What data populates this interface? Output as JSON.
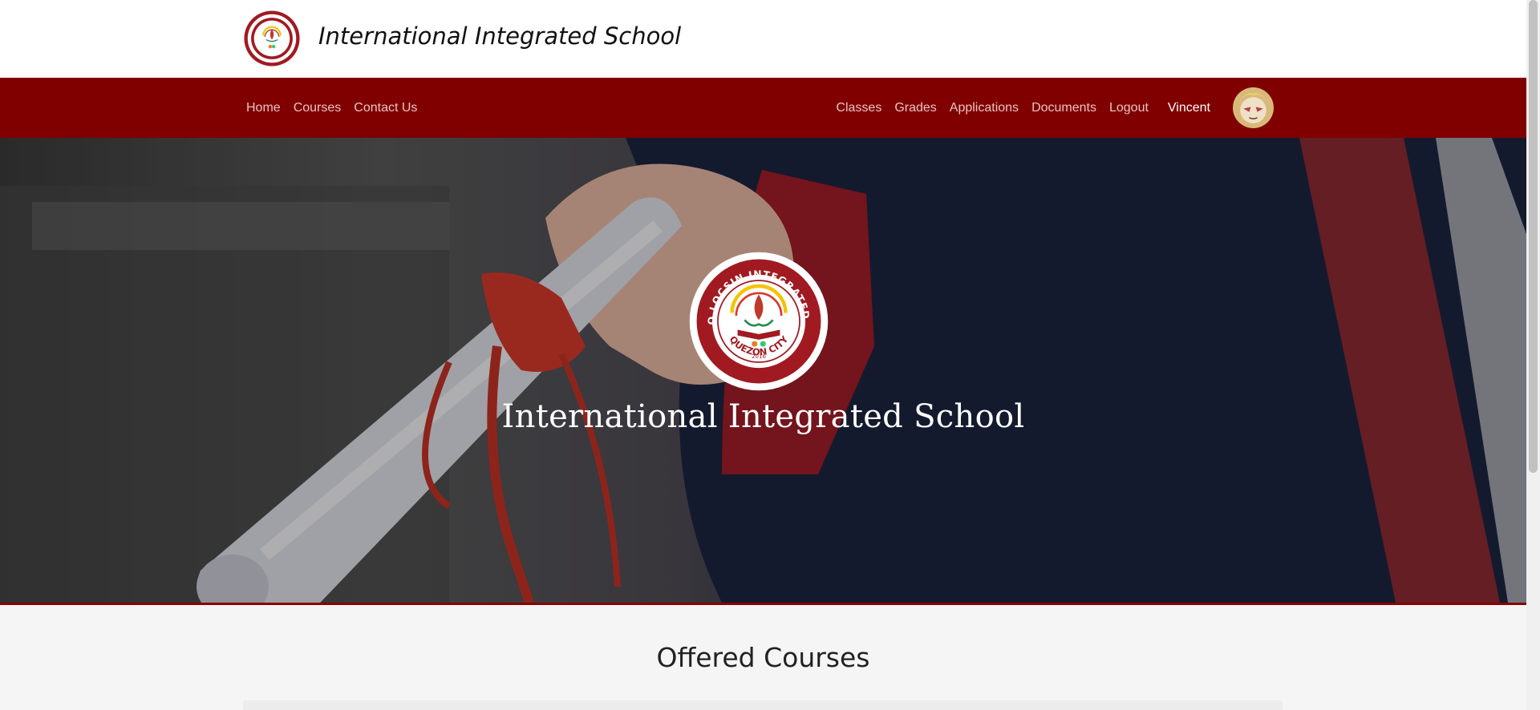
{
  "brand": {
    "title": "International Integrated School",
    "logo_icon": "school-seal-icon"
  },
  "nav": {
    "left": [
      "Home",
      "Courses",
      "Contact Us"
    ],
    "right": [
      "Classes",
      "Grades",
      "Applications",
      "Documents",
      "Logout"
    ],
    "user_name": "Vincent",
    "avatar_icon": "user-avatar-icon"
  },
  "hero": {
    "title": "International Integrated School",
    "seal": {
      "top_text": "LEANDRO LOCSIN INTEGRATED SCHOOL",
      "bottom_text": "QUEZON CITY",
      "year": "2016"
    }
  },
  "section": {
    "title": "Offered Courses"
  },
  "colors": {
    "primary": "#800000",
    "background": "#f5f5f5"
  }
}
